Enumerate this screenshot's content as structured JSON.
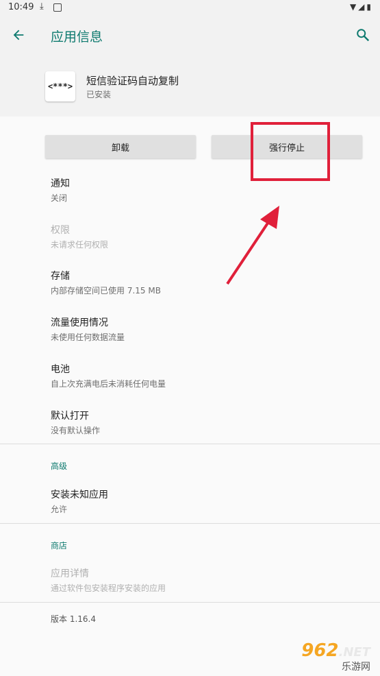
{
  "status_bar": {
    "time": "10:49",
    "download_glyph": "⤓",
    "right_glyphs": "▼◢▮"
  },
  "app_bar": {
    "title": "应用信息"
  },
  "app": {
    "icon_text": "<***>",
    "name": "短信验证码自动复制",
    "status": "已安装"
  },
  "buttons": {
    "uninstall": "卸载",
    "force_stop": "强行停止"
  },
  "items": [
    {
      "title": "通知",
      "subtitle": "关闭"
    },
    {
      "title": "权限",
      "subtitle": "未请求任何权限"
    },
    {
      "title": "存储",
      "subtitle": "内部存储空间已使用 7.15 MB"
    },
    {
      "title": "流量使用情况",
      "subtitle": "未使用任何数据流量"
    },
    {
      "title": "电池",
      "subtitle": "自上次充满电后未消耗任何电量"
    },
    {
      "title": "默认打开",
      "subtitle": "没有默认操作"
    }
  ],
  "advanced": {
    "header": "高级",
    "items": [
      {
        "title": "安装未知应用",
        "subtitle": "允许"
      }
    ]
  },
  "store": {
    "header": "商店",
    "items": [
      {
        "title": "应用详情",
        "subtitle": "通过软件包安装程序安装的应用"
      }
    ]
  },
  "version": "版本 1.16.4",
  "watermark": {
    "number": "962",
    "net": ".NET",
    "subtitle": "乐游网"
  },
  "colors": {
    "accent": "#0e7a6f",
    "annotation": "#e0203a"
  }
}
